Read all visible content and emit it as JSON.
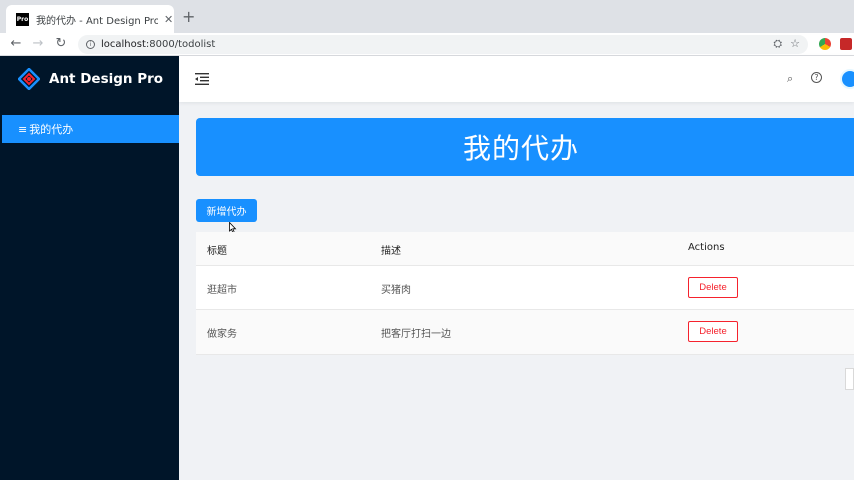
{
  "browser": {
    "tab_title": "我的代办 - Ant Design Pro",
    "favicon_text": "Pro",
    "tab_close": "✕",
    "new_tab": "+",
    "url_host": "localhost",
    "url_rest": ":8000/todolist"
  },
  "sidebar": {
    "logo_text": "Ant Design Pro",
    "menu_items": [
      {
        "label": "我的代办",
        "icon": "≡"
      }
    ]
  },
  "banner": {
    "title": "我的代办"
  },
  "toolbar": {
    "add_label": "新增代办"
  },
  "table": {
    "columns": [
      "标题",
      "描述",
      "Actions"
    ],
    "rows": [
      {
        "title": "逛超市",
        "description": "买猪肉",
        "action": "Delete"
      },
      {
        "title": "做家务",
        "description": "把客厅打扫一边",
        "action": "Delete"
      }
    ]
  },
  "colors": {
    "primary": "#1890ff",
    "sider": "#001529",
    "danger": "#f5222d"
  }
}
